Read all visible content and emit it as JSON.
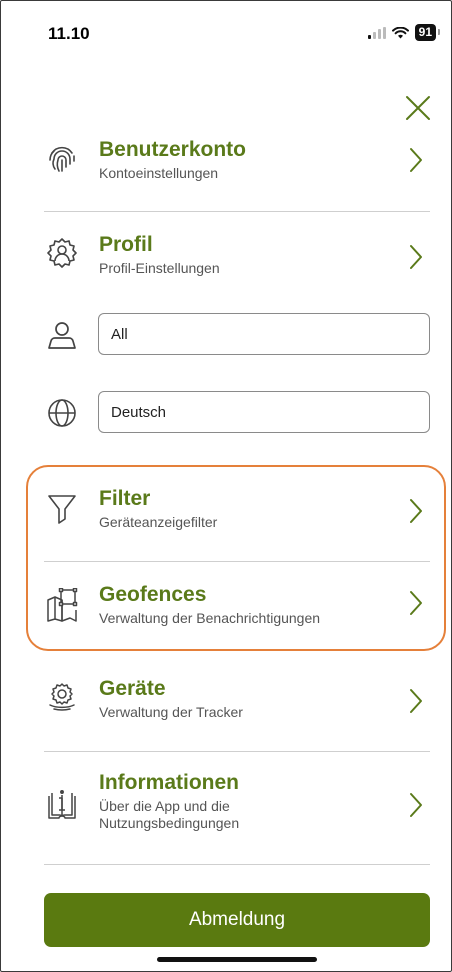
{
  "status_bar": {
    "time": "11.10",
    "battery": "91"
  },
  "menu": {
    "account": {
      "title": "Benutzerkonto",
      "subtitle": "Kontoeinstellungen"
    },
    "profile": {
      "title": "Profil",
      "subtitle": "Profil-Einstellungen"
    },
    "profile_select": {
      "value": "All"
    },
    "language_select": {
      "value": "Deutsch"
    },
    "filter": {
      "title": "Filter",
      "subtitle": "Geräteanzeigefilter"
    },
    "geofences": {
      "title": "Geofences",
      "subtitle": "Verwaltung der Benachrichtigungen"
    },
    "devices": {
      "title": "Geräte",
      "subtitle": "Verwaltung der Tracker"
    },
    "info": {
      "title": "Informationen",
      "subtitle_line1": "Über die App und die",
      "subtitle_line2": "Nutzungsbedingungen"
    }
  },
  "logout": {
    "label": "Abmeldung"
  },
  "colors": {
    "accent": "#5a7a10",
    "title": "#5a7a1a",
    "highlight": "#e5803a"
  },
  "icons": {
    "close": "close-icon",
    "account": "fingerprint-icon",
    "profile": "profile-gear-icon",
    "user": "user-icon",
    "language": "globe-icon",
    "filter": "filter-funnel-icon",
    "geofences": "geofence-map-icon",
    "devices": "device-tracker-icon",
    "info": "info-book-icon",
    "chevron": "chevron-right-icon"
  }
}
